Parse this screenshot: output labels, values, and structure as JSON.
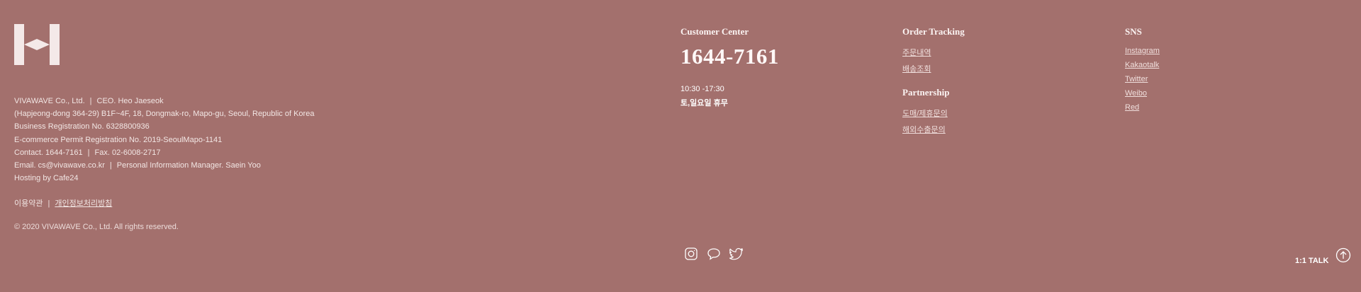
{
  "company": {
    "line1": {
      "name": "VIVAWAVE Co., Ltd.",
      "ceo": "CEO. Heo Jaeseok"
    },
    "address": "(Hapjeong-dong 364-29) B1F~4F, 18, Dongmak-ro, Mapo-gu, Seoul, Republic of Korea",
    "business_reg": "Business Registration No. 6328800936",
    "ecommerce_reg": "E-commerce Permit Registration No. 2019-SeoulMapo-1141",
    "contact": {
      "tel": "Contact. 1644-7161",
      "fax": "Fax. 02-6008-2717"
    },
    "email_line": {
      "email": "Email. cs@vivawave.co.kr",
      "manager": "Personal Information Manager. Saein Yoo"
    },
    "hosting": "Hosting by Cafe24",
    "separator": "|"
  },
  "links": {
    "terms": "이용약관",
    "privacy": "개인정보처리방침",
    "separator": "|"
  },
  "copyright": "© 2020 VIVAWAVE Co., Ltd. All rights reserved.",
  "customer_center": {
    "title": "Customer Center",
    "phone": "1644-7161",
    "hours": "10:30 -17:30",
    "closed": "토,일요일 휴무"
  },
  "order_tracking": {
    "title": "Order Tracking",
    "items": [
      "주문내역",
      "배송조회"
    ]
  },
  "partnership": {
    "title": "Partnership",
    "items": [
      "도매/제휴문의",
      "해외수출문의"
    ]
  },
  "sns": {
    "title": "SNS",
    "items": [
      "Instagram",
      "Kakaotalk",
      "Twitter",
      "Weibo",
      "Red"
    ]
  },
  "social_icons": [
    "instagram-icon",
    "speech-bubble-icon",
    "twitter-icon"
  ],
  "floating": {
    "talk": "1:1 TALK"
  },
  "colors": {
    "background": "#a3706d",
    "text": "#f2e6e4"
  }
}
